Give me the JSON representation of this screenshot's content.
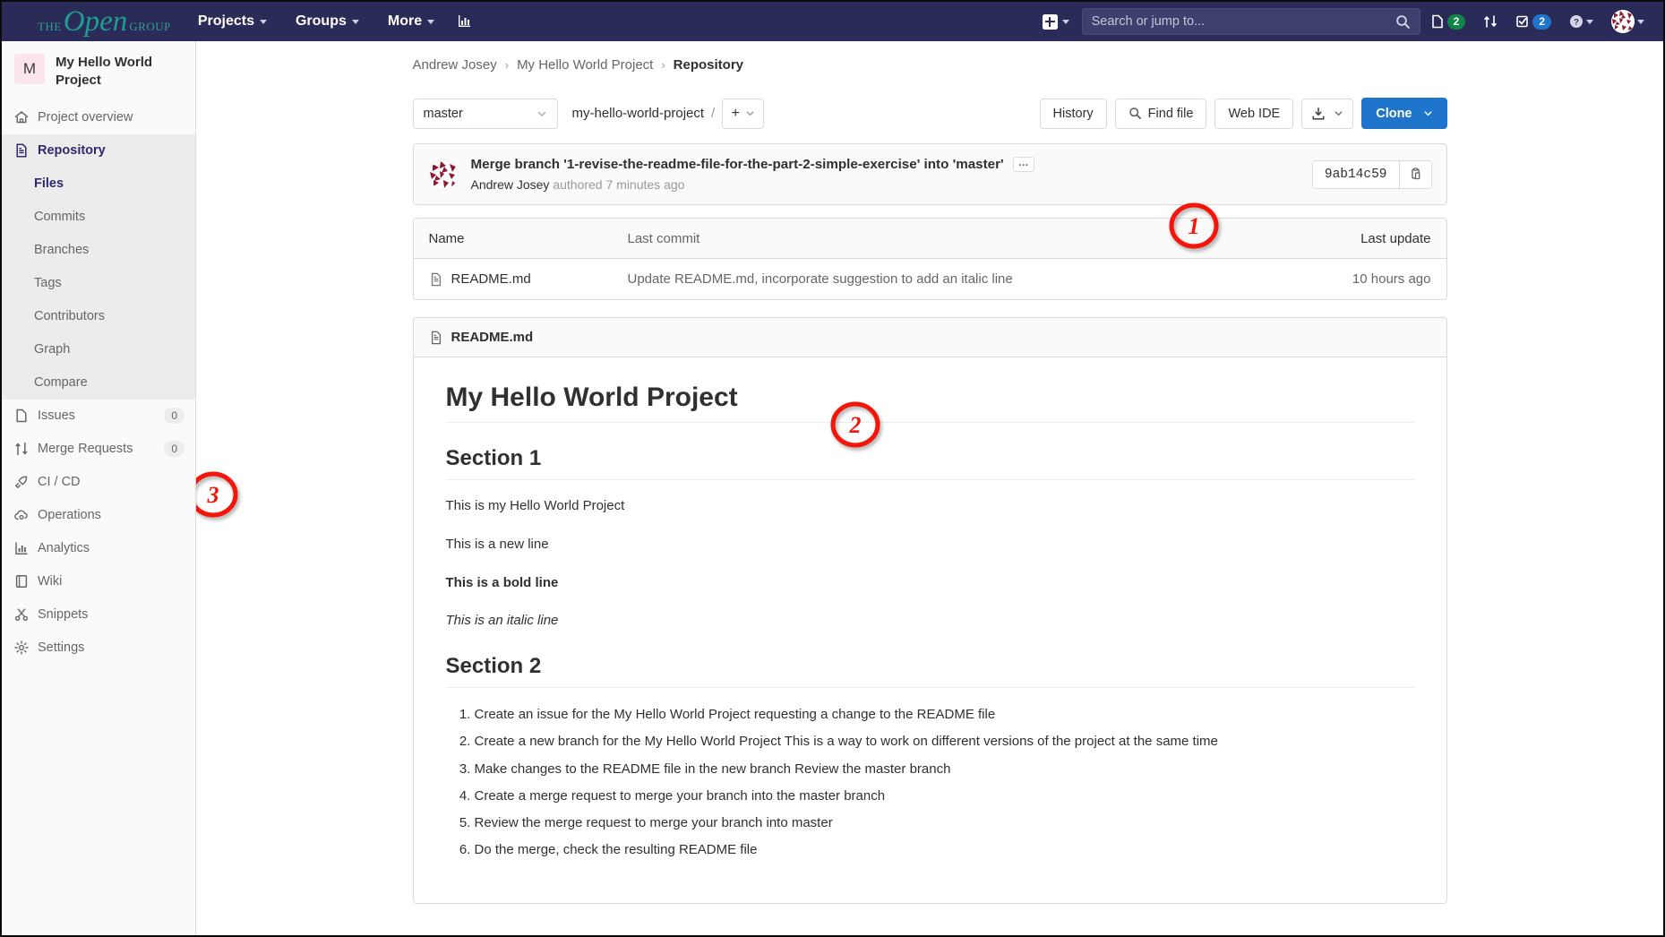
{
  "topnav": {
    "brand": {
      "the": "THE",
      "open": "Open",
      "group": "GROUP"
    },
    "items": [
      {
        "label": "Projects",
        "name": "nav-projects"
      },
      {
        "label": "Groups",
        "name": "nav-groups"
      },
      {
        "label": "More",
        "name": "nav-more"
      }
    ],
    "analytics_icon": "chart-icon",
    "new_label": "new-dropdown",
    "search": {
      "placeholder": "Search or jump to...",
      "value": ""
    },
    "issues_count": "2",
    "todos_count": "2"
  },
  "sidebar": {
    "project": {
      "initial": "M",
      "name": "My Hello World Project"
    },
    "items": [
      {
        "label": "Project overview",
        "icon": "home-icon",
        "count": ""
      },
      {
        "label": "Repository",
        "icon": "doc-icon",
        "count": ""
      },
      {
        "label": "Issues",
        "icon": "issue-icon",
        "count": "0"
      },
      {
        "label": "Merge Requests",
        "icon": "merge-icon",
        "count": "0"
      },
      {
        "label": "CI / CD",
        "icon": "rocket-icon",
        "count": ""
      },
      {
        "label": "Operations",
        "icon": "cloud-gear-icon",
        "count": ""
      },
      {
        "label": "Analytics",
        "icon": "chart-icon",
        "count": ""
      },
      {
        "label": "Wiki",
        "icon": "book-icon",
        "count": ""
      },
      {
        "label": "Snippets",
        "icon": "scissors-icon",
        "count": ""
      },
      {
        "label": "Settings",
        "icon": "gear-icon",
        "count": ""
      }
    ],
    "repo_subitems": [
      {
        "label": "Files"
      },
      {
        "label": "Commits"
      },
      {
        "label": "Branches"
      },
      {
        "label": "Tags"
      },
      {
        "label": "Contributors"
      },
      {
        "label": "Graph"
      },
      {
        "label": "Compare"
      }
    ]
  },
  "breadcrumb": {
    "user": "Andrew Josey",
    "project": "My Hello World Project",
    "current": "Repository",
    "sep": "›"
  },
  "toolbar": {
    "branch": "master",
    "path": "my-hello-world-project",
    "path_sep": "/",
    "add_label": "+",
    "history": "History",
    "find_file": "Find file",
    "web_ide": "Web IDE",
    "download": "download-icon",
    "clone": "Clone"
  },
  "commit": {
    "title": "Merge branch '1-revise-the-readme-file-for-the-part-2-simple-exercise' into 'master'",
    "more": "…",
    "author": "Andrew Josey",
    "meta": "authored 7 minutes ago",
    "sha": "9ab14c59"
  },
  "files": {
    "headers": {
      "name": "Name",
      "last_commit": "Last commit",
      "last_update": "Last update"
    },
    "rows": [
      {
        "name": "README.md",
        "last_commit": "Update README.md, incorporate suggestion to add an italic line",
        "last_update": "10 hours ago"
      }
    ]
  },
  "readme": {
    "filename": "README.md",
    "h1": "My Hello World Project",
    "section1_title": "Section 1",
    "p1": "This is my Hello World Project",
    "p2": "This is a new line",
    "p3": "This is a bold line",
    "p4": "This is an italic line",
    "section2_title": "Section 2",
    "list": [
      "Create an issue for the My Hello World Project requesting a change to the README file",
      "Create a new branch for the My Hello World Project This is a way to work on different versions of the project at the same time",
      "Make changes to the README file in the new branch Review the master branch",
      "Create a merge request to merge your branch into the master branch",
      "Review the merge request to merge your branch into master",
      "Do the merge, check the resulting README file"
    ]
  },
  "annotations": [
    {
      "id": "1",
      "label": "1"
    },
    {
      "id": "2",
      "label": "2"
    },
    {
      "id": "3",
      "label": "3"
    }
  ],
  "colors": {
    "nav_bg": "#2b2b59",
    "accent_blue": "#1f75cb",
    "active_indigo": "#2f2a6b",
    "annotation_red": "#f5160b",
    "badge_green": "#108548"
  }
}
